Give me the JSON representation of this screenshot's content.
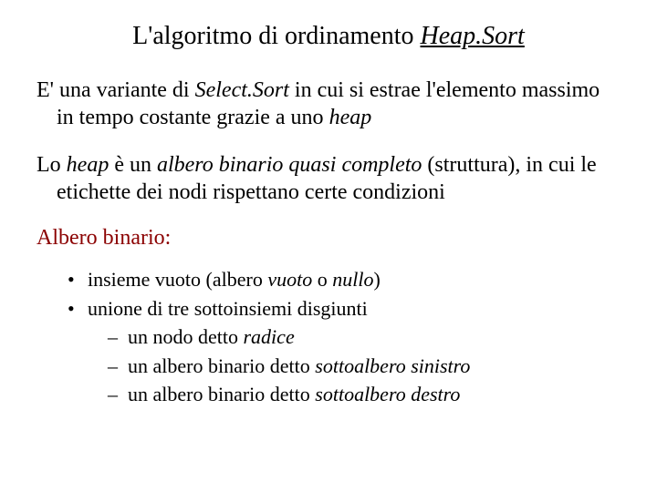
{
  "title": {
    "pre": "L'algoritmo di ordinamento ",
    "heapsort": "Heap.Sort"
  },
  "p1": {
    "a": "E' una variante di ",
    "b": "Select.Sort",
    "c": "  in cui si estrae l'elemento massimo in tempo costante grazie a uno ",
    "d": "heap"
  },
  "p2": {
    "a": "Lo ",
    "b": "heap",
    "c": " è un ",
    "d": "albero binario quasi completo",
    "e": " (struttura), in cui le etichette dei nodi rispettano certe condizioni"
  },
  "heading": "Albero binario:",
  "bul1": {
    "a": "insieme vuoto (albero ",
    "b": "vuoto",
    "c": " o ",
    "d": "nullo",
    "e": ")"
  },
  "bul2": "unione di tre sottoinsiemi disgiunti",
  "sub1": {
    "a": "un nodo detto ",
    "b": "radice"
  },
  "sub2": {
    "a": "un albero binario detto ",
    "b": "sottoalbero sinistro"
  },
  "sub3": {
    "a": "un albero binario detto ",
    "b": "sottoalbero destro"
  }
}
